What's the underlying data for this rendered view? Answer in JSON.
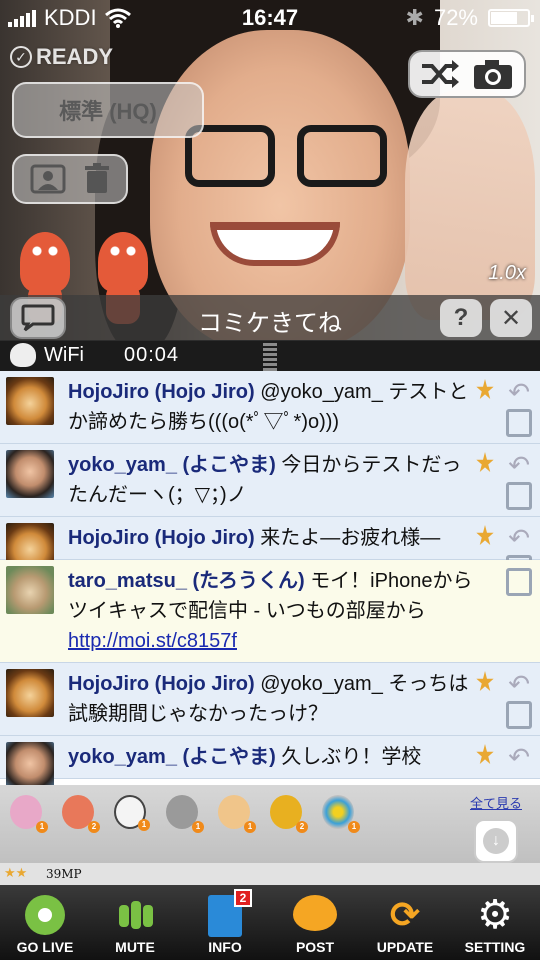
{
  "status": {
    "carrier": "KDDI",
    "time": "16:47",
    "battery": "72%",
    "battery_level": 0.72
  },
  "video": {
    "ready_label": "READY",
    "quality_label": "標準 (HQ)",
    "zoom": "1.0x"
  },
  "banner": {
    "comment": "コミケきてね",
    "hint_icon": "?",
    "close_icon": "✕"
  },
  "infobar": {
    "network": "WiFi",
    "elapsed": "00:04"
  },
  "comments": [
    {
      "name": "HojoJiro (Hojo Jiro)",
      "text": "@yoko_yam_ テストとか諦めたら勝ち(((o(*ﾟ▽ﾟ*)o)))",
      "avatar": "tiger"
    },
    {
      "name": "yoko_yam_ (よこやま)",
      "text": "今日からテストだったんだーヽ(；▽；)ノ",
      "avatar": "girl"
    },
    {
      "name": "HojoJiro (Hojo Jiro)",
      "text": "来たよ—お疲れ様—",
      "avatar": "tiger"
    },
    {
      "name": "taro_matsu_ (たろうくん)",
      "text": "モイ！iPhoneからツイキャスで配信中 - いつもの部屋から",
      "link": "http://moi.st/c8157f",
      "avatar": "dog"
    },
    {
      "name": "HojoJiro (Hojo Jiro)",
      "text": "@yoko_yam_ そっちは試験期間じゃなかったっけ？",
      "avatar": "tiger"
    },
    {
      "name": "yoko_yam_ (よこやま)",
      "text": "久しぶり！学校",
      "avatar": "girl"
    }
  ],
  "stamps": {
    "see_all": "全て見る",
    "counts": [
      "1",
      "2",
      "1",
      "1",
      "1",
      "2",
      "1"
    ]
  },
  "mp": {
    "value": "39MP"
  },
  "tabs": [
    {
      "label": "GO LIVE",
      "icon": "go-live-icon"
    },
    {
      "label": "MUTE",
      "icon": "mute-icon"
    },
    {
      "label": "INFO",
      "icon": "info-icon",
      "badge": "2"
    },
    {
      "label": "POST",
      "icon": "post-icon"
    },
    {
      "label": "UPDATE",
      "icon": "update-icon"
    },
    {
      "label": "SETTING",
      "icon": "setting-icon"
    }
  ],
  "colors": {
    "accent_green": "#7ac144",
    "accent_orange": "#f5a623",
    "name_blue": "#1a2a7a",
    "link_blue": "#1a2ab0"
  }
}
